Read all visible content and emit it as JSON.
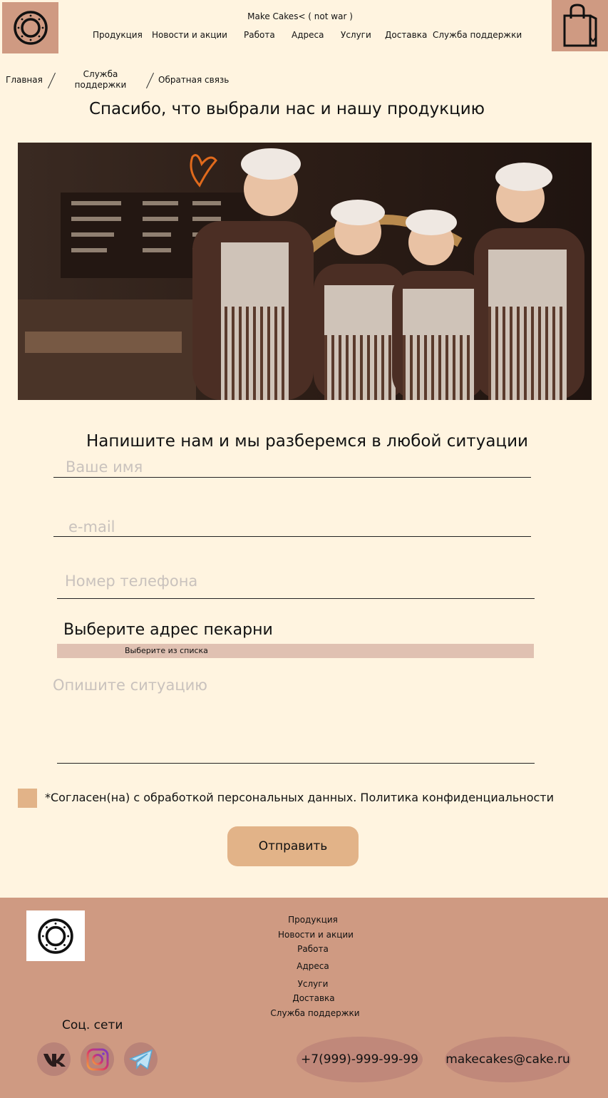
{
  "header": {
    "brand": "Make Cakes< ( not war )",
    "nav": [
      "Продукция",
      "Новости и акции",
      "Работа",
      "Адреса",
      "Услуги",
      "Доставка",
      "Служба поддержки"
    ]
  },
  "breadcrumb": {
    "home": "Главная",
    "support_line1": "Служба",
    "support_line2": "поддержки",
    "current": "Обратная связь"
  },
  "thanks_title": "Спасибо, что выбрали нас и нашу продукцию",
  "form": {
    "title": "Напишите нам и мы разберемся в любой ситуации",
    "name_placeholder": "Ваше имя",
    "email_placeholder": "e-mail",
    "phone_placeholder": "Номер телефона",
    "address_title": "Выберите адрес пекарни",
    "address_select": "Выберите из списка",
    "situation_placeholder": "Опишите ситуацию",
    "consent": "*Согласен(на) с обработкой персональных данных. Политика конфиденциальности",
    "submit": "Отправить"
  },
  "footer": {
    "links": [
      "Продукция",
      "Новости и акции",
      "Работа",
      "Адреса",
      "Услуги",
      "Доставка",
      "Служба поддержки"
    ],
    "social_title": "Соц. сети",
    "phone": "+7(999)-999-99-99",
    "email": "makecakes@cake.ru"
  },
  "colors": {
    "background": "#fff4e0",
    "accent": "#cf9a82",
    "button": "#e2b388",
    "select": "#e0c1b2"
  }
}
